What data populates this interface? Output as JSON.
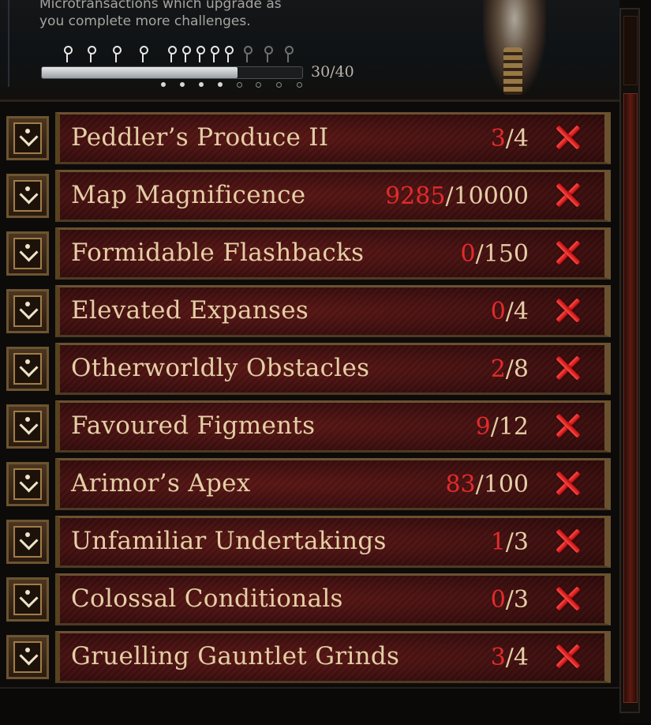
{
  "header": {
    "description_line1": "Microtransactions which upgrade as",
    "description_line2": "you complete more challenges.",
    "progress_text": "30/40",
    "progress_completed": 30,
    "progress_total": 40
  },
  "challenges": [
    {
      "title": "Peddler’s Produce II",
      "current": "3",
      "total": "4",
      "status": "incomplete"
    },
    {
      "title": "Map Magnificence",
      "current": "9285",
      "total": "10000",
      "status": "incomplete"
    },
    {
      "title": "Formidable Flashbacks",
      "current": "0",
      "total": "150",
      "status": "incomplete"
    },
    {
      "title": "Elevated Expanses",
      "current": "0",
      "total": "4",
      "status": "incomplete"
    },
    {
      "title": "Otherworldly Obstacles",
      "current": "2",
      "total": "8",
      "status": "incomplete"
    },
    {
      "title": "Favoured Figments",
      "current": "9",
      "total": "12",
      "status": "incomplete"
    },
    {
      "title": "Arimor’s Apex",
      "current": "83",
      "total": "100",
      "status": "incomplete"
    },
    {
      "title": "Unfamiliar Undertakings",
      "current": "1",
      "total": "3",
      "status": "incomplete"
    },
    {
      "title": "Colossal Conditionals",
      "current": "0",
      "total": "3",
      "status": "incomplete"
    },
    {
      "title": "Gruelling Gauntlet Grinds",
      "current": "3",
      "total": "4",
      "status": "incomplete"
    }
  ],
  "colors": {
    "current_value": "#e32b2b",
    "text": "#e4cfa6",
    "status_incomplete": "#d61a1a"
  },
  "icons": {
    "row_icon": "expand-chevron-icon",
    "status_icon": "red-x-icon"
  }
}
